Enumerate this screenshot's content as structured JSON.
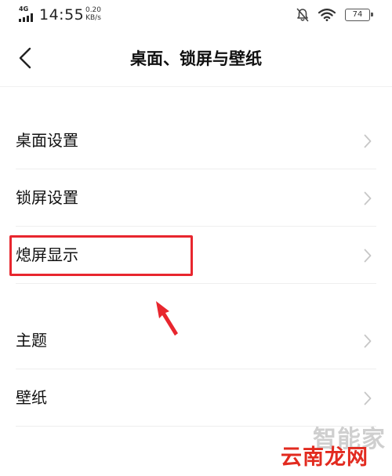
{
  "status_bar": {
    "network_type": "4G",
    "time": "14:55",
    "speed_value": "0.20",
    "speed_unit": "KB/s",
    "battery_level": "74",
    "icons": [
      "signal-icon",
      "mute-icon",
      "wifi-icon",
      "battery-icon"
    ]
  },
  "header": {
    "title": "桌面、锁屏与壁纸",
    "back_icon": "chevron-left-icon"
  },
  "groups": [
    {
      "items": [
        {
          "label": "桌面设置"
        },
        {
          "label": "锁屏设置"
        },
        {
          "label": "熄屏显示"
        }
      ]
    },
    {
      "items": [
        {
          "label": "主题"
        },
        {
          "label": "壁纸"
        }
      ]
    }
  ],
  "annotation": {
    "highlight_color": "#e8262e",
    "arrow_color": "#e8262e"
  },
  "watermark": {
    "top_text": "智能家",
    "bottom_text": "云南龙网"
  },
  "colors": {
    "background": "#ffffff",
    "text": "#111111",
    "chevron": "#c7c7c7",
    "divider": "#eeeeee"
  }
}
